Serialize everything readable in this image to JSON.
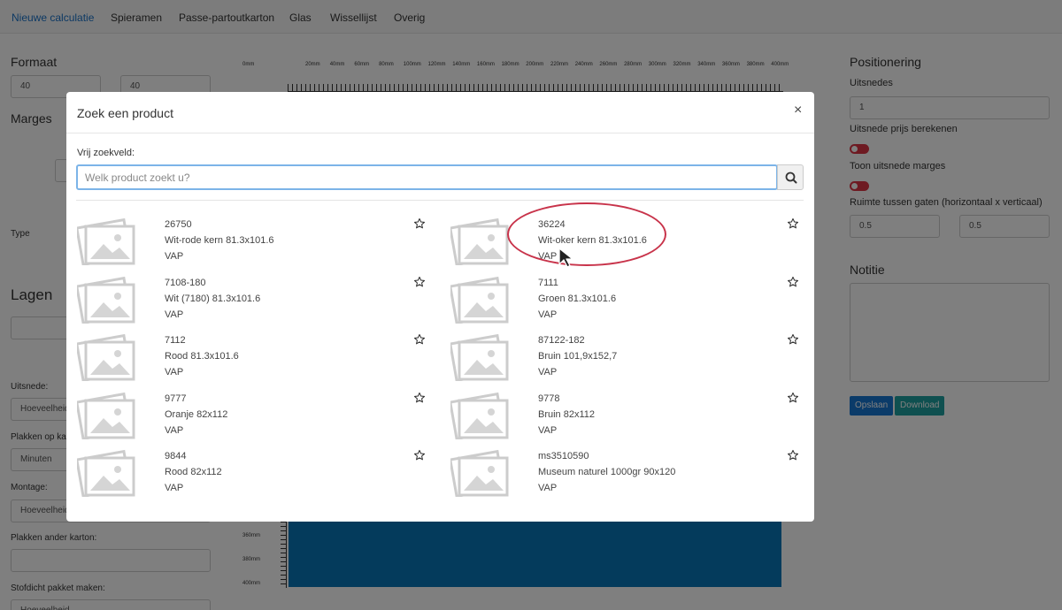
{
  "navbar": {
    "items": [
      {
        "label": "Nieuwe calculatie",
        "active": true
      },
      {
        "label": "Spieramen"
      },
      {
        "label": "Passe-partoutkarton"
      },
      {
        "label": "Glas"
      },
      {
        "label": "Wissellijst"
      },
      {
        "label": "Overig"
      }
    ]
  },
  "left_panel": {
    "formaat_title": "Formaat",
    "width_value": "40",
    "height_value": "40",
    "marges_title": "Marges",
    "type_label": "Type",
    "lagen_title": "Lagen",
    "uitsnede_label": "Uitsnede:",
    "uitsnede_placeholder": "Hoeveelheid",
    "plakken_op_karton_label": "Plakken op karton:",
    "minuten_placeholder": "Minuten",
    "montage_label": "Montage:",
    "montage_placeholder": "Hoeveelheid",
    "plakken_ander_label": "Plakken ander karton:",
    "stofdicht_label": "Stofdicht pakket maken:",
    "stofdicht_placeholder": "Hoeveelheid"
  },
  "ruler": {
    "top_labels": [
      "0mm",
      "20mm",
      "40mm",
      "60mm",
      "80mm",
      "100mm",
      "120mm",
      "140mm",
      "160mm",
      "180mm",
      "200mm",
      "220mm",
      "240mm",
      "260mm",
      "280mm",
      "300mm",
      "320mm",
      "340mm",
      "360mm",
      "380mm",
      "400mm"
    ],
    "left_labels": [
      "360mm",
      "380mm",
      "400mm"
    ]
  },
  "right_panel": {
    "positionering_title": "Positionering",
    "uitsnedes_label": "Uitsnedes",
    "uitsnedes_value": "1",
    "uitsnede_prijs_label": "Uitsnede prijs berekenen",
    "toon_marges_label": "Toon uitsnede marges",
    "ruimte_label": "Ruimte tussen gaten (horizontaal x verticaal)",
    "ruimte_h_value": "0.5",
    "ruimte_v_value": "0.5",
    "notitie_title": "Notitie",
    "save_label": "Opslaan",
    "download_label": "Download",
    "toggle_color": "#dc3545"
  },
  "modal": {
    "title": "Zoek een product",
    "close_label": "×",
    "search_label": "Vrij zoekveld:",
    "search_placeholder": "Welk product zoekt u?",
    "search_value": "",
    "search_icon": "search-icon",
    "products": [
      {
        "code": "26750",
        "name": "Wit-rode kern 81.3x101.6",
        "brand": "VAP"
      },
      {
        "code": "36224",
        "name": "Wit-oker kern 81.3x101.6",
        "brand": "VAP",
        "highlighted": true
      },
      {
        "code": "7108-180",
        "name": "Wit (7180) 81.3x101.6",
        "brand": "VAP"
      },
      {
        "code": "7111",
        "name": "Groen 81.3x101.6",
        "brand": "VAP"
      },
      {
        "code": "7112",
        "name": "Rood 81.3x101.6",
        "brand": "VAP"
      },
      {
        "code": "87122-182",
        "name": "Bruin 101,9x152,7",
        "brand": "VAP"
      },
      {
        "code": "9777",
        "name": "Oranje 82x112",
        "brand": "VAP"
      },
      {
        "code": "9778",
        "name": "Bruin 82x112",
        "brand": "VAP"
      },
      {
        "code": "9844",
        "name": "Rood 82x112",
        "brand": "VAP"
      },
      {
        "code": "ms3510590",
        "name": "Museum naturel 1000gr 90x120",
        "brand": "VAP"
      }
    ],
    "highlight_color": "#c8334a",
    "accent_color": "#7cb4e8"
  }
}
